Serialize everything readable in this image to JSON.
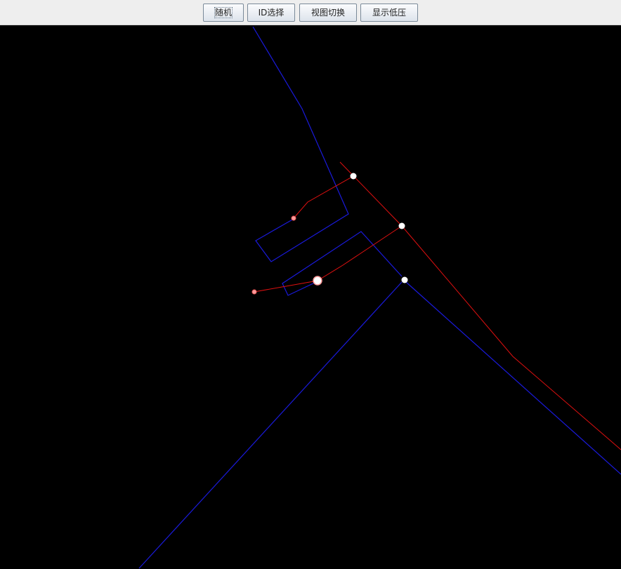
{
  "toolbar": {
    "buttons": [
      {
        "label": "随机"
      },
      {
        "label": "ID选择"
      },
      {
        "label": "视图切换"
      },
      {
        "label": "显示低压"
      }
    ]
  },
  "canvas": {
    "background": "#000000",
    "colors": {
      "blue_line": "#1a1adc",
      "red_line": "#e01010",
      "white_node": "#ffffff",
      "pink_node": "#ff8c8c"
    }
  }
}
